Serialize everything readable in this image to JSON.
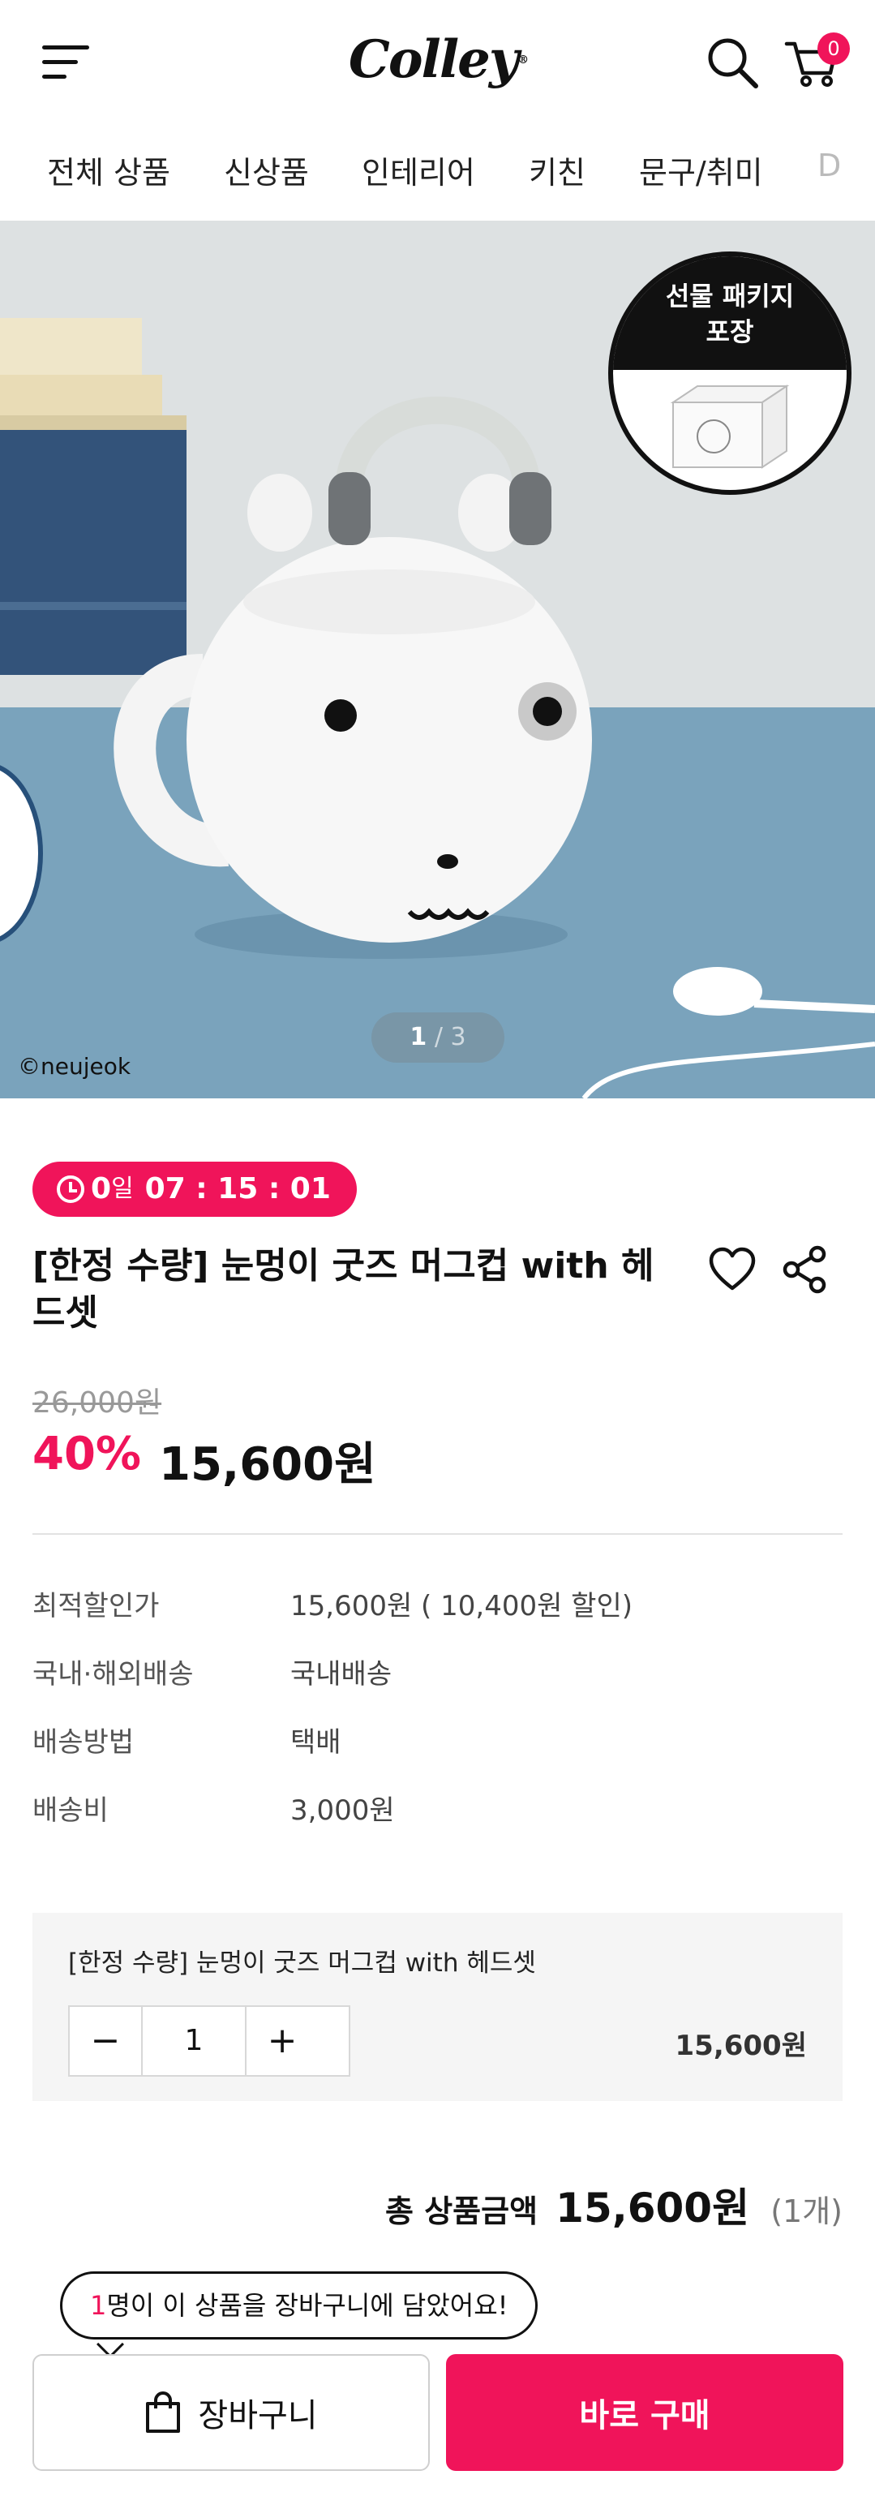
{
  "header": {
    "logo": "Colley",
    "logo_mark": "®",
    "cart_count": "0"
  },
  "categories": [
    "전체 상품",
    "신상품",
    "인테리어",
    "키친",
    "문구/취미",
    "D"
  ],
  "hero": {
    "page_current": "1",
    "page_separator": "/",
    "page_total": "3",
    "credit": "©neujeok",
    "gift_line1": "선물 패키지",
    "gift_line2": "포장"
  },
  "timer": {
    "days": "0",
    "day_unit": "일",
    "time": "07 : 15 : 01"
  },
  "product": {
    "title": "[한정 수량] 눈멍이 굿즈 머그컵 with 헤드셋",
    "original_price": "26,000원",
    "discount": "40%",
    "sale_price": "15,600원"
  },
  "info": [
    {
      "label": "최적할인가",
      "value": "15,600원 ( 10,400원 할인)"
    },
    {
      "label": "국내·해외배송",
      "value": "국내배송"
    },
    {
      "label": "배송방법",
      "value": "택배"
    },
    {
      "label": "배송비",
      "value": "3,000원"
    }
  ],
  "option": {
    "name": "[한정 수량] 눈멍이 굿즈 머그컵 with 헤드셋",
    "minus": "−",
    "quantity": "1",
    "plus": "+",
    "price": "15,600원"
  },
  "total": {
    "label": "총 상품금액",
    "amount": "15,600원",
    "count": "(1개)"
  },
  "tooltip": {
    "num": "1",
    "text": "명이 이 상품을 장바구니에 담았어요!"
  },
  "buttons": {
    "cart": "장바구니",
    "buy": "바로 구매"
  },
  "colors": {
    "accent": "#f0145a"
  }
}
